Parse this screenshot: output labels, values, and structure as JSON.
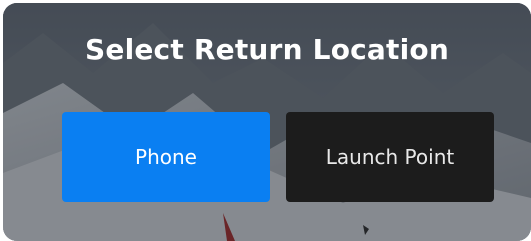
{
  "dialog": {
    "title": "Select Return Location",
    "buttons": {
      "phone_label": "Phone",
      "launch_point_label": "Launch Point"
    }
  },
  "colors": {
    "primary_button": "#0a7ff2",
    "secondary_button": "#1c1c1c",
    "title_text": "#ffffff"
  }
}
